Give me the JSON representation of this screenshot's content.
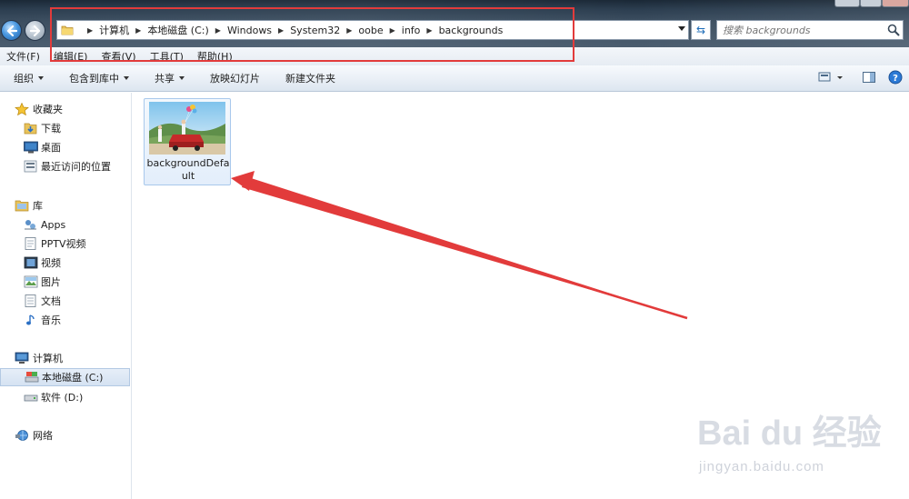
{
  "address": {
    "crumbs": [
      "计算机",
      "本地磁盘 (C:)",
      "Windows",
      "System32",
      "oobe",
      "info",
      "backgrounds"
    ]
  },
  "search": {
    "placeholder": "搜索 backgrounds"
  },
  "menu": [
    "文件(F)",
    "编辑(E)",
    "查看(V)",
    "工具(T)",
    "帮助(H)"
  ],
  "toolbar": {
    "organize": "组织",
    "include_library": "包含到库中",
    "share": "共享",
    "slideshow": "放映幻灯片",
    "new_folder": "新建文件夹"
  },
  "sidebar": {
    "favorites": {
      "header": "收藏夹",
      "items": [
        "下载",
        "桌面",
        "最近访问的位置"
      ]
    },
    "libraries": {
      "header": "库",
      "items": [
        "Apps",
        "PPTV视频",
        "视频",
        "图片",
        "文档",
        "音乐"
      ]
    },
    "computer": {
      "header": "计算机",
      "items": [
        "本地磁盘 (C:)",
        "软件 (D:)"
      ]
    },
    "network": {
      "header": "网络"
    }
  },
  "files": [
    {
      "name": "backgroundDefault"
    }
  ],
  "watermark": {
    "logo": "Bai du 经验",
    "url": "jingyan.baidu.com"
  },
  "colors": {
    "annotation": "#e23b3b",
    "selection": "#d5e2f2",
    "titlebar": "#2c3e50"
  }
}
